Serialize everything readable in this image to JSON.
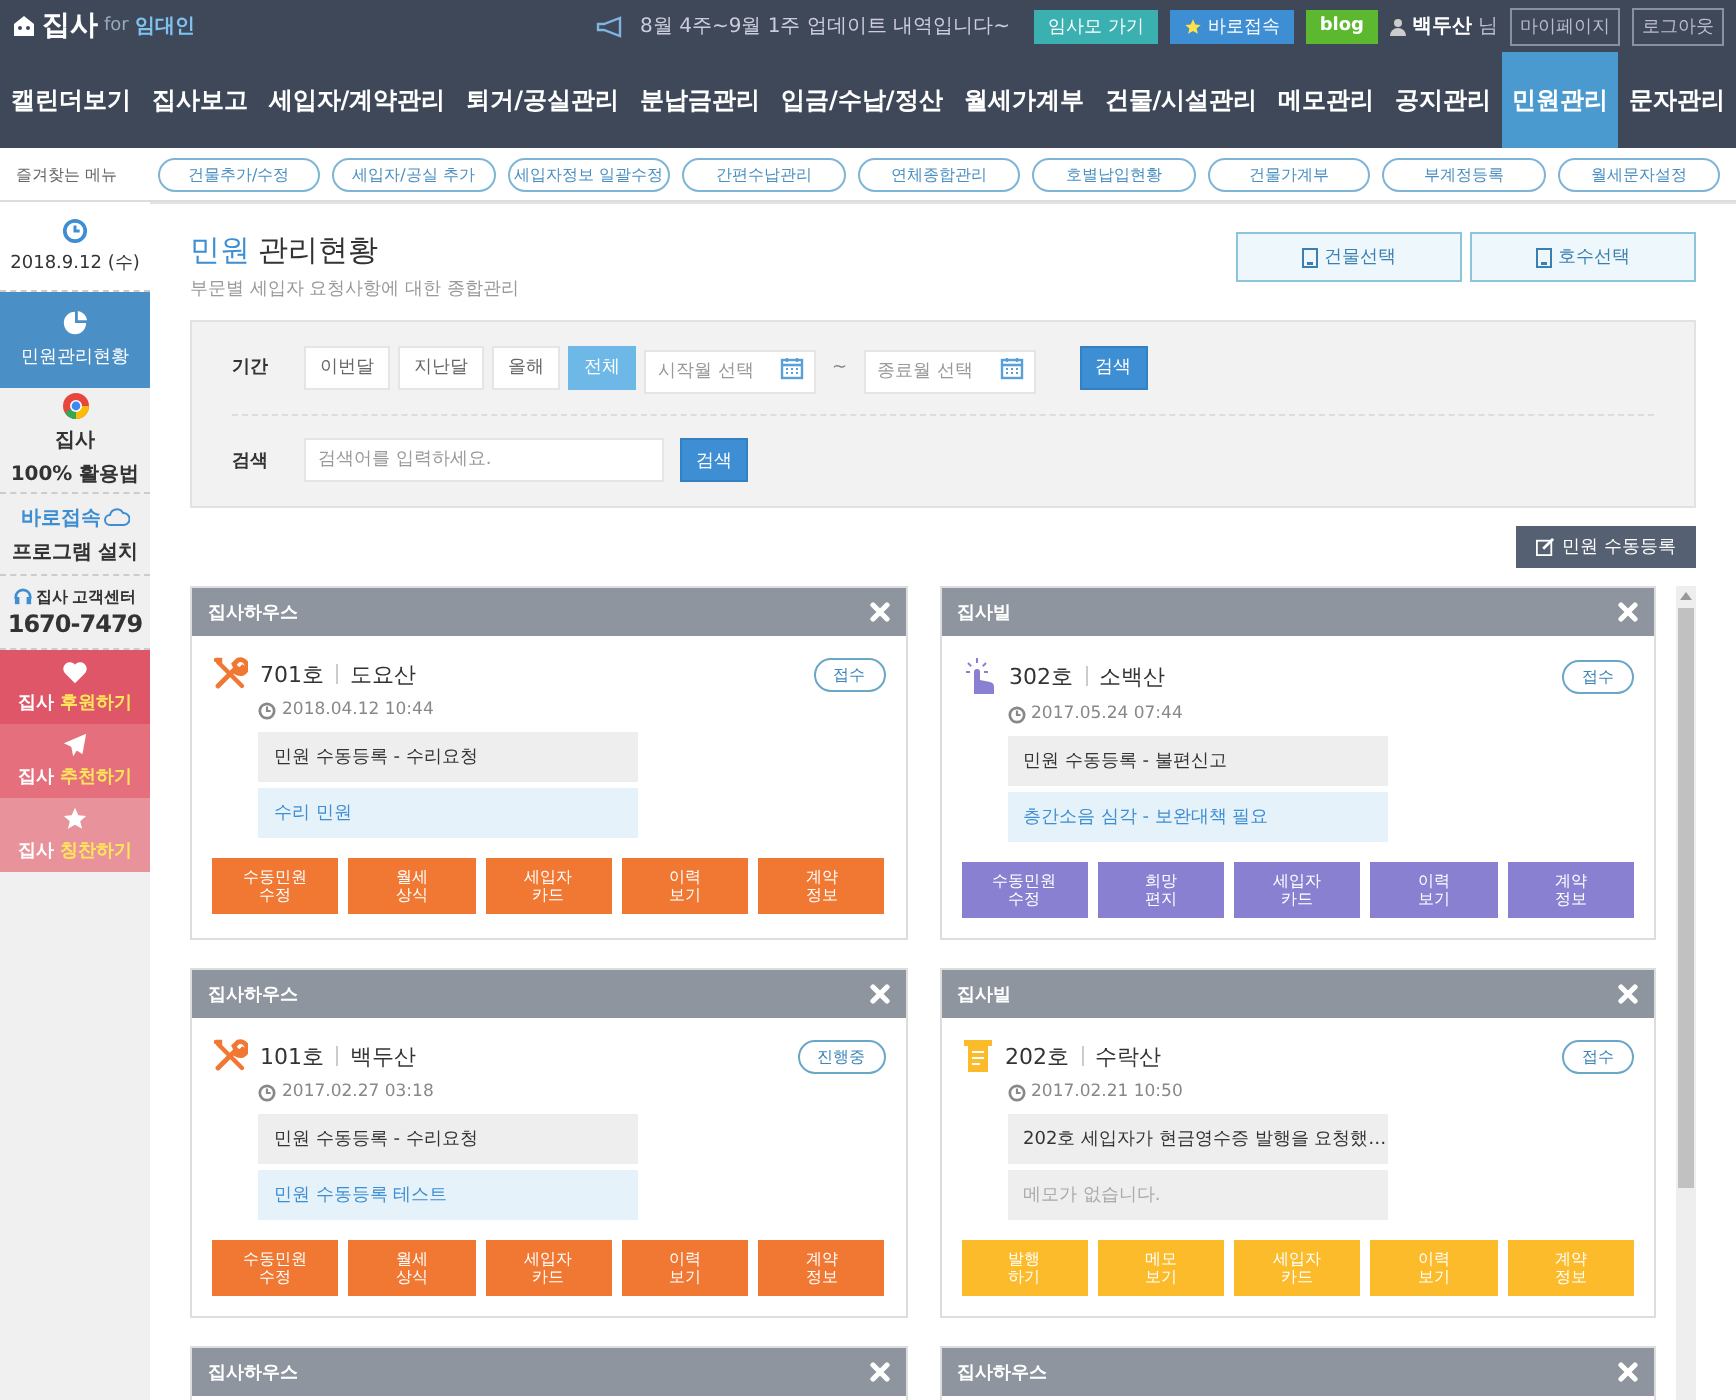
{
  "header": {
    "logo": "집사",
    "logo_for": "for",
    "logo_role": "임대인",
    "notice": "8월 4주~9월 1주 업데이트 내역입니다~",
    "buttons": [
      {
        "label": "임사모 가기",
        "kind": "teal"
      },
      {
        "label": "바로접속",
        "kind": "star"
      },
      {
        "label": "blog",
        "kind": "blog"
      }
    ],
    "user": "백두산",
    "user_suffix": "님",
    "links": [
      "마이페이지",
      "로그아웃"
    ]
  },
  "nav": [
    {
      "label": "캘린더보기",
      "selected": false
    },
    {
      "label": "집사보고",
      "selected": false
    },
    {
      "label": "세입자/계약관리",
      "selected": false
    },
    {
      "label": "퇴거/공실관리",
      "selected": false
    },
    {
      "label": "분납금관리",
      "selected": false
    },
    {
      "label": "입금/수납/정산",
      "selected": false
    },
    {
      "label": "월세가계부",
      "selected": false
    },
    {
      "label": "건물/시설관리",
      "selected": false
    },
    {
      "label": "메모관리",
      "selected": false
    },
    {
      "label": "공지관리",
      "selected": false
    },
    {
      "label": "민원관리",
      "selected": true
    },
    {
      "label": "문자관리",
      "selected": false
    }
  ],
  "favorites": {
    "label": "즐겨찾는 메뉴",
    "items": [
      "건물추가/수정",
      "세입자/공실 추가",
      "세입자정보 일괄수정",
      "간편수납관리",
      "연체종합관리",
      "호별납입현황",
      "건물가계부",
      "부계정등록",
      "월세문자설정"
    ]
  },
  "sidebar": {
    "date": "2018.9.12 (수)",
    "menu_item": {
      "label": "민원관리현황",
      "selected": true
    },
    "guide": {
      "title": "집사",
      "subtitle": "100% 활용법"
    },
    "quick": {
      "title": "바로접속",
      "subtitle": "프로그램 설치"
    },
    "support": {
      "brand": "집사",
      "title": "고객센터",
      "phone": "1670-7479"
    },
    "actions": [
      {
        "brand": "집사",
        "label": "후원하기",
        "kind": "heart",
        "color": "#e05669"
      },
      {
        "brand": "집사",
        "label": "추천하기",
        "kind": "send",
        "color": "#e56f7d"
      },
      {
        "brand": "집사",
        "label": "칭찬하기",
        "kind": "star",
        "color": "#e8939b"
      }
    ]
  },
  "page": {
    "title_highlight": "민원",
    "title": "관리현황",
    "subtitle": "부문별 세입자 요청사항에 대한 종합관리",
    "selectors": [
      "건물선택",
      "호수선택"
    ]
  },
  "filter": {
    "period_label": "기간",
    "periods": [
      {
        "label": "이번달",
        "selected": false
      },
      {
        "label": "지난달",
        "selected": false
      },
      {
        "label": "올해",
        "selected": false
      },
      {
        "label": "전체",
        "selected": true
      }
    ],
    "start_placeholder": "시작월 선택",
    "separator": "~",
    "end_placeholder": "종료월 선택",
    "period_button": "검색",
    "search_label": "검색",
    "search_placeholder": "검색어를 입력하세요.",
    "search_button": "검색"
  },
  "register_button": "민원 수동등록",
  "cards": [
    {
      "building": "집사하우스",
      "kind": "repair",
      "color": "#f07832",
      "room": "701호",
      "tenant": "도요산",
      "status": "접수",
      "date": "2018.04.12 10:44",
      "request": "민원 수동등록 - 수리요청",
      "memo": {
        "text": "수리 민원",
        "empty": false
      },
      "actions": [
        [
          "수동민원",
          "수정"
        ],
        [
          "월세",
          "상식"
        ],
        [
          "세입자",
          "카드"
        ],
        [
          "이력",
          "보기"
        ],
        [
          "계약",
          "정보"
        ]
      ]
    },
    {
      "building": "집사빌",
      "kind": "touch",
      "color": "#8a80d2",
      "room": "302호",
      "tenant": "소백산",
      "status": "접수",
      "date": "2017.05.24 07:44",
      "request": "민원 수동등록 - 불편신고",
      "memo": {
        "text": "층간소음 심각 - 보완대책 필요",
        "empty": false
      },
      "actions": [
        [
          "수동민원",
          "수정"
        ],
        [
          "희망",
          "편지"
        ],
        [
          "세입자",
          "카드"
        ],
        [
          "이력",
          "보기"
        ],
        [
          "계약",
          "정보"
        ]
      ]
    },
    {
      "building": "집사하우스",
      "kind": "repair",
      "color": "#f07832",
      "room": "101호",
      "tenant": "백두산",
      "status": "진행중",
      "date": "2017.02.27 03:18",
      "request": "민원 수동등록 - 수리요청",
      "memo": {
        "text": "민원 수동등록 테스트",
        "empty": false
      },
      "actions": [
        [
          "수동민원",
          "수정"
        ],
        [
          "월세",
          "상식"
        ],
        [
          "세입자",
          "카드"
        ],
        [
          "이력",
          "보기"
        ],
        [
          "계약",
          "정보"
        ]
      ]
    },
    {
      "building": "집사빌",
      "kind": "receipt",
      "color": "#fbbb2a",
      "room": "202호",
      "tenant": "수락산",
      "status": "접수",
      "date": "2017.02.21 10:50",
      "request": "202호 세입자가 현금영수증 발행을 요청했…",
      "memo": {
        "text": "메모가 없습니다.",
        "empty": true
      },
      "actions": [
        [
          "발행",
          "하기"
        ],
        [
          "메모",
          "보기"
        ],
        [
          "세입자",
          "카드"
        ],
        [
          "이력",
          "보기"
        ],
        [
          "계약",
          "정보"
        ]
      ]
    }
  ],
  "partial_cards": [
    {
      "building": "집사하우스"
    },
    {
      "building": "집사하우스"
    }
  ]
}
